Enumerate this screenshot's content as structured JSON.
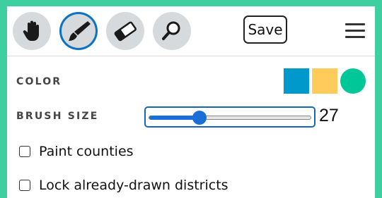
{
  "toolbar": {
    "tools": [
      {
        "name": "pan",
        "icon": "hand-icon",
        "active": false
      },
      {
        "name": "brush",
        "icon": "brush-icon",
        "active": true
      },
      {
        "name": "erase",
        "icon": "eraser-icon",
        "active": false
      },
      {
        "name": "inspect",
        "icon": "magnifier-icon",
        "active": false
      }
    ],
    "save_label": "Save",
    "menu_icon": "hamburger-menu-icon"
  },
  "color": {
    "label": "COLOR",
    "swatches": [
      {
        "color": "#0099cc",
        "shape": "square",
        "selected": false
      },
      {
        "color": "#ffcc5c",
        "shape": "square",
        "selected": false
      },
      {
        "color": "#00c798",
        "shape": "circle",
        "selected": true
      }
    ]
  },
  "brush_size": {
    "label": "BRUSH SIZE",
    "value": "27",
    "fraction": 0.31
  },
  "options": [
    {
      "label": "Paint counties",
      "checked": false
    },
    {
      "label": "Lock already-drawn districts",
      "checked": false
    }
  ],
  "colors": {
    "background": "#3ecfa0",
    "accent": "#1a6fd6"
  }
}
